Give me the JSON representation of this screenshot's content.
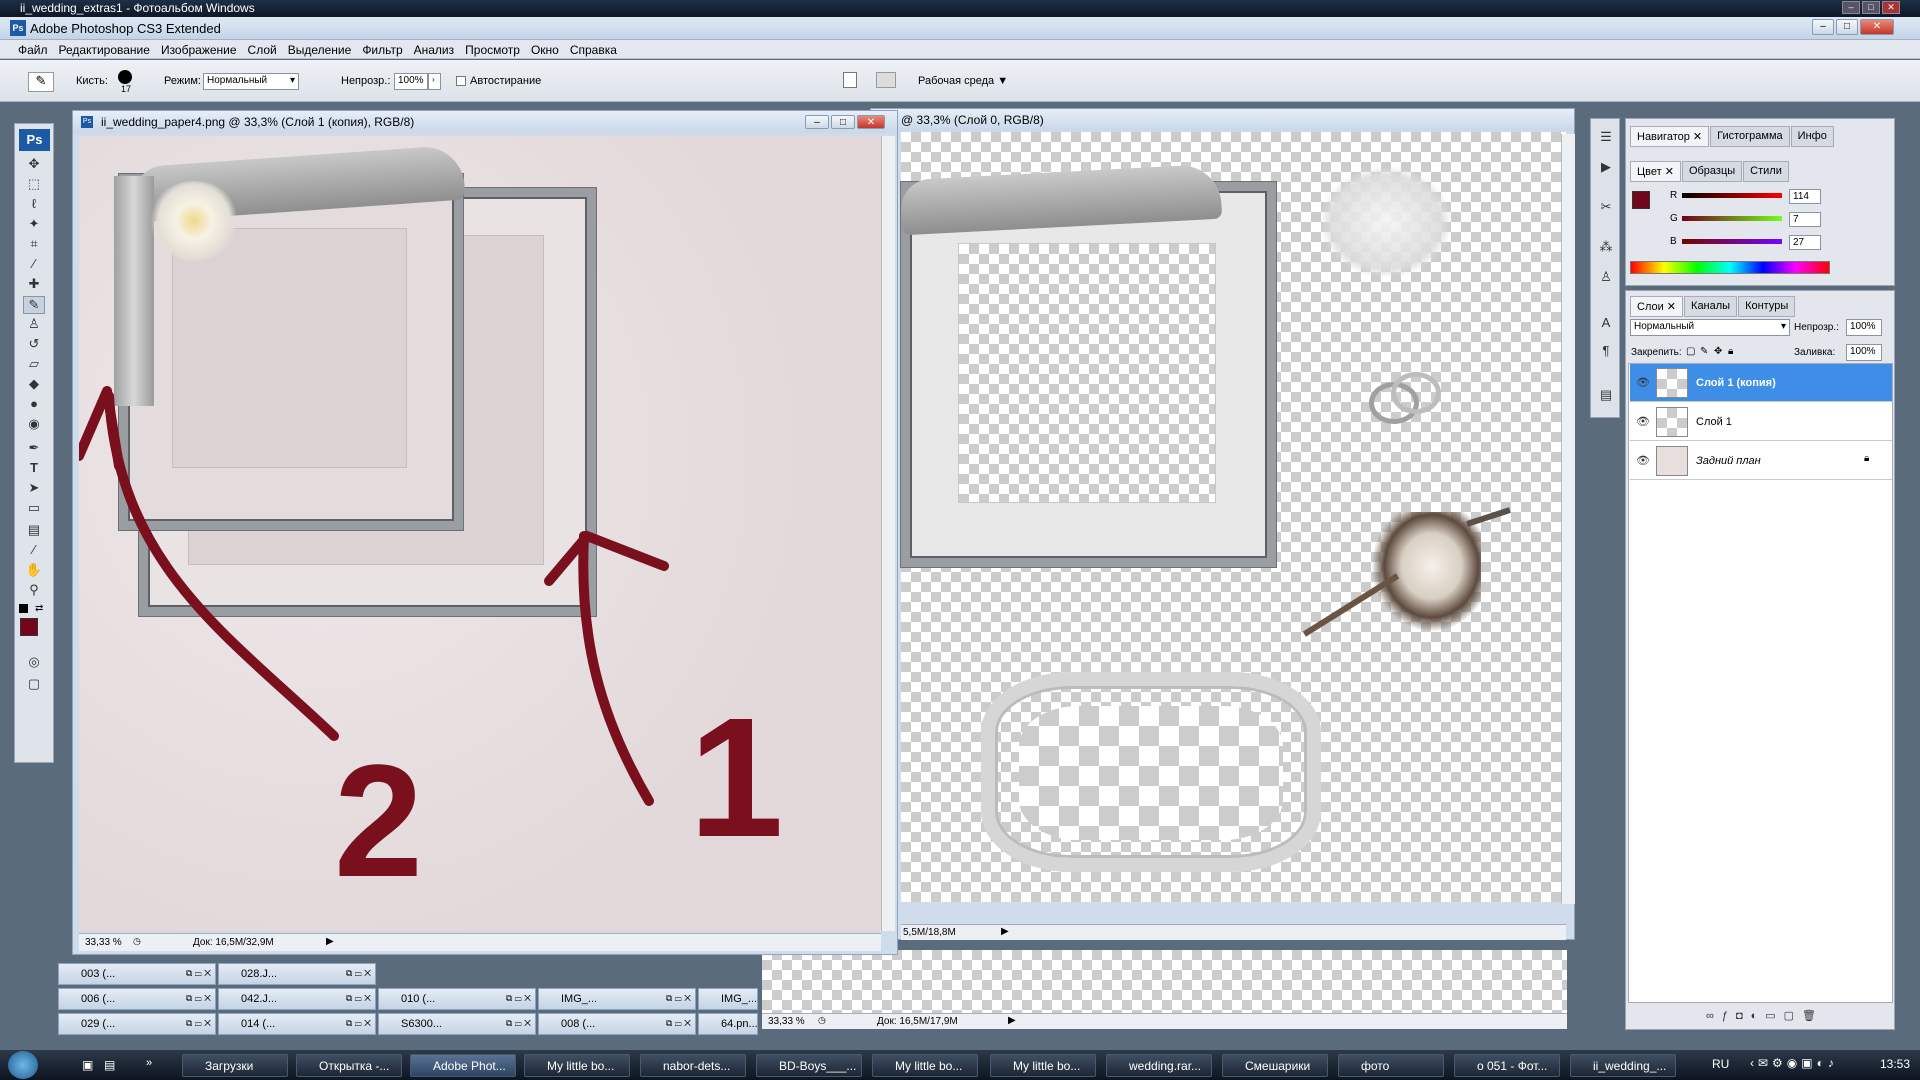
{
  "window": {
    "outer_title": "ii_wedding_extras1 - Фотоальбом Windows",
    "app_title": "Adobe Photoshop CS3 Extended"
  },
  "menu": [
    "Файл",
    "Редактирование",
    "Изображение",
    "Слой",
    "Выделение",
    "Фильтр",
    "Анализ",
    "Просмотр",
    "Окно",
    "Справка"
  ],
  "options": {
    "brush_label": "Кисть:",
    "brush_size": "17",
    "mode_label": "Режим:",
    "mode_value": "Нормальный",
    "opacity_label": "Непрозр.:",
    "opacity_value": "100%",
    "auto_erase_label": "Автостирание",
    "workspace_label": "Рабочая среда"
  },
  "toolbox": {
    "logo": "Ps"
  },
  "doc_left": {
    "title": "ii_wedding_paper4.png @ 33,3% (Слой 1 (копия), RGB/8)",
    "zoom": "33,33 %",
    "doc_info": "Док: 16,5M/32,9M"
  },
  "doc_right": {
    "title": "@ 33,3% (Слой 0, RGB/8)",
    "doc_info": "5,5M/18,8M"
  },
  "doc_bottom": {
    "zoom": "33,33 %",
    "doc_info": "Док: 16,5M/17,9M"
  },
  "annotations": {
    "label_1": "1",
    "label_2": "2"
  },
  "minimized_docs": [
    [
      "003 (...",
      "028.J...",
      "",
      ""
    ],
    [
      "006 (...",
      "042.J...",
      "010 (...",
      "IMG_...",
      "IMG_..."
    ],
    [
      "029 (...",
      "014 (...",
      "S6300...",
      "008 (...",
      "64.pn..."
    ]
  ],
  "panels": {
    "top_tabs": [
      "Навигатор",
      "Гистограмма",
      "Инфо"
    ],
    "color_tabs": [
      "Цвет",
      "Образцы",
      "Стили"
    ],
    "r_label": "R",
    "g_label": "G",
    "b_label": "B",
    "r_value": "114",
    "g_value": "7",
    "b_value": "27",
    "fg_color": "#72071b",
    "layers_tabs": [
      "Слои",
      "Каналы",
      "Контуры"
    ],
    "blend_mode": "Нормальный",
    "opacity_label": "Непрозр.:",
    "opacity_value": "100%",
    "lock_label": "Закрепить:",
    "fill_label": "Заливка:",
    "fill_value": "100%",
    "layers": [
      "Слой 1 (копия)",
      "Слой 1",
      "Задний план"
    ]
  },
  "taskbar": {
    "items": [
      "Загрузки",
      "Открытка -...",
      "Adobe Phot...",
      "My little bo...",
      "nabor-dets...",
      "BD-Boys___...",
      "My little bo...",
      "My little bo...",
      "wedding.rar...",
      "Смешарики",
      "фото",
      "о 051 - Фот...",
      "ii_wedding_..."
    ],
    "lang": "RU",
    "time": "13:53"
  },
  "colors": {
    "annotation": "#7a0f1e",
    "accent_selected": "#3e8ee8"
  }
}
